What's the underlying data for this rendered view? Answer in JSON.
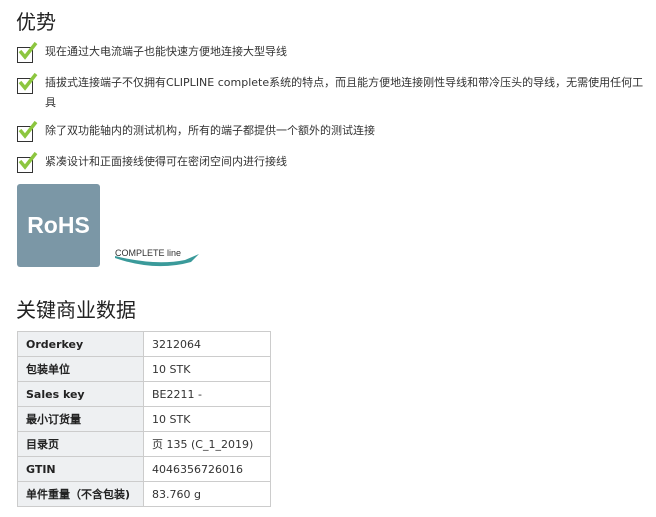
{
  "advantages": {
    "title": "优势",
    "items": [
      "现在通过大电流端子也能快速方便地连接大型导线",
      "插拔式连接端子不仅拥有CLIPLINE complete系统的特点，而且能方便地连接刚性导线和带冷压头的导线，无需使用任何工具",
      "除了双功能轴内的测试机构，所有的端子都提供一个额外的测试连接",
      "紧凑设计和正面接线使得可在密闭空间内进行接线"
    ]
  },
  "logos": {
    "rohs": "RoHS",
    "complete_line": "COMPLETE line"
  },
  "key_data": {
    "title": "关键商业数据",
    "rows": [
      {
        "key": "Orderkey",
        "value": "3212064"
      },
      {
        "key": "包装单位",
        "value": "10 STK"
      },
      {
        "key": "Sales key",
        "value": "BE2211 -"
      },
      {
        "key": "最小订货量",
        "value": "10 STK"
      },
      {
        "key": "目录页",
        "value": "页 135 (C_1_2019)"
      },
      {
        "key": "GTIN",
        "value": "4046356726016"
      },
      {
        "key": "单件重量（不含包装)",
        "value": "83.760 g"
      }
    ]
  },
  "colors": {
    "check": "#8cc63f",
    "rohs_bg": "#7b97a6"
  }
}
